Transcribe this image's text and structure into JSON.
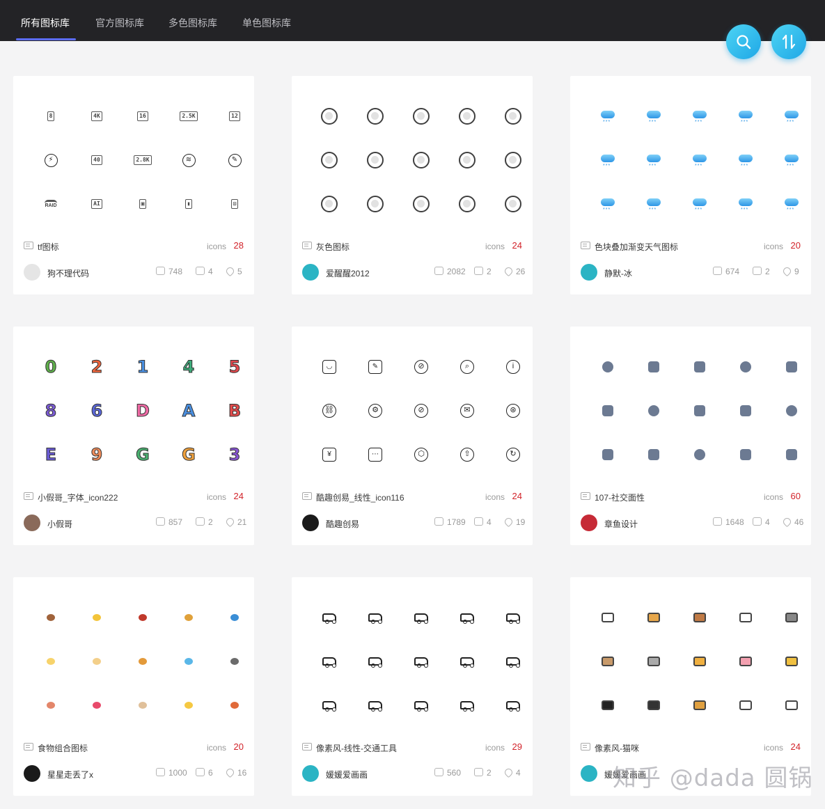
{
  "nav": {
    "tabs": [
      "所有图标库",
      "官方图标库",
      "多色图标库",
      "单色图标库"
    ],
    "active_tab": 0
  },
  "fab": {
    "search_icon": "search-icon",
    "sort_icon": "sort-icon"
  },
  "cards": [
    {
      "name": "tf图标",
      "icons_label": "icons",
      "count": "28",
      "author": "狗不理代码",
      "views": "748",
      "likes": "4",
      "favs": "5",
      "glyphs": [
        "8",
        "4K",
        "16",
        "2.5K",
        "12",
        "⚡",
        "40",
        "2.8K",
        "≋",
        "✎",
        "RAID",
        "AI",
        "▣",
        "▮",
        "⊡"
      ]
    },
    {
      "name": "灰色图标",
      "icons_label": "icons",
      "count": "24",
      "author": "爱醒醒2012",
      "views": "2082",
      "likes": "2",
      "favs": "26"
    },
    {
      "name": "色块叠加渐变天气图标",
      "icons_label": "icons",
      "count": "20",
      "author": "静默-冰",
      "views": "674",
      "likes": "2",
      "favs": "9"
    },
    {
      "name": "小假哥_字体_icon222",
      "icons_label": "icons",
      "count": "24",
      "author": "小假哥",
      "views": "857",
      "likes": "2",
      "favs": "21",
      "glyphs": [
        "0",
        "2",
        "1",
        "4",
        "5",
        "8",
        "6",
        "D",
        "A",
        "B",
        "E",
        "9",
        "G",
        "G",
        "3"
      ]
    },
    {
      "name": "酷趣创易_线性_icon116",
      "icons_label": "icons",
      "count": "24",
      "author": "酷趣创易",
      "views": "1789",
      "likes": "4",
      "favs": "19",
      "glyphs": [
        "◡",
        "✎",
        "⊘",
        "⌕",
        "i",
        "⛓",
        "⚙",
        "⊘",
        "✉",
        "⊛",
        "¥",
        "⋯",
        "⬡",
        "⇧",
        "↻"
      ]
    },
    {
      "name": "107-社交面性",
      "icons_label": "icons",
      "count": "60",
      "author": "章鱼设计",
      "views": "1648",
      "likes": "4",
      "favs": "46"
    },
    {
      "name": "食物组合图标",
      "icons_label": "icons",
      "count": "20",
      "author": "星星走丢了x",
      "views": "1000",
      "likes": "6",
      "favs": "16"
    },
    {
      "name": "像素风-线性-交通工具",
      "icons_label": "icons",
      "count": "29",
      "author": "媛媛爱画画",
      "views": "560",
      "likes": "2",
      "favs": "4"
    },
    {
      "name": "像素风-猫咪",
      "icons_label": "icons",
      "count": "24",
      "author": "媛媛爱画画",
      "views": "",
      "likes": "",
      "favs": ""
    }
  ],
  "colors": {
    "accent": "#5b6cf5",
    "count_red": "#d2232a",
    "topbar": "#232326",
    "fab": "#1fa7e6"
  },
  "watermark": "知乎 @dada 圆锅"
}
